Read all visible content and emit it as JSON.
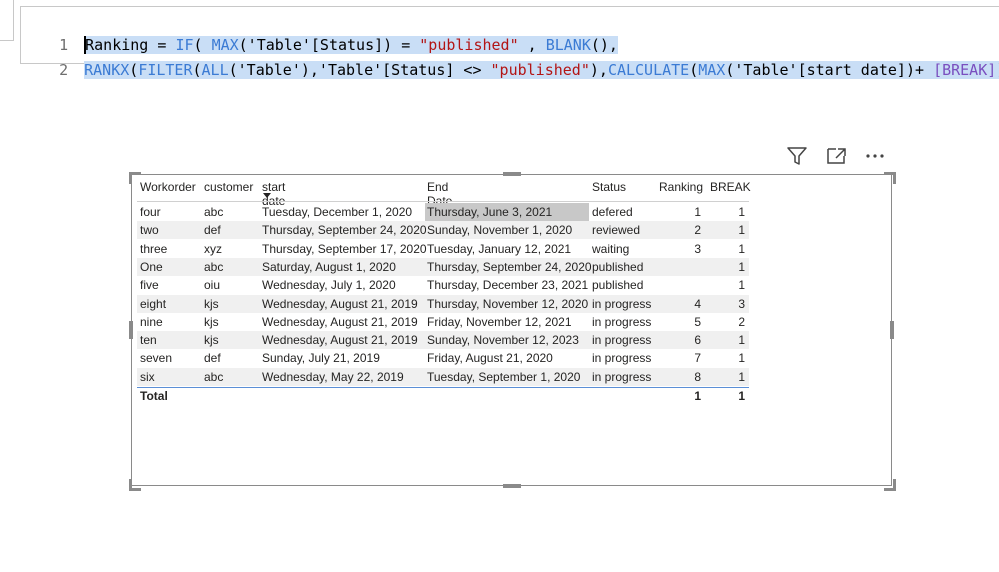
{
  "formula": {
    "line1_number": "1",
    "line2_number": "2",
    "line1": [
      {
        "t": "Ranking = ",
        "c": "tk-default"
      },
      {
        "t": "IF",
        "c": "tk-fn"
      },
      {
        "t": "( ",
        "c": "tk-default"
      },
      {
        "t": "MAX",
        "c": "tk-fn"
      },
      {
        "t": "('Table'[Status]) = ",
        "c": "tk-tbl"
      },
      {
        "t": "\"published\"",
        "c": "tk-str"
      },
      {
        "t": " , ",
        "c": "tk-default"
      },
      {
        "t": "BLANK",
        "c": "tk-fn"
      },
      {
        "t": "(),",
        "c": "tk-default"
      }
    ],
    "line2": [
      {
        "t": "RANKX",
        "c": "tk-fn"
      },
      {
        "t": "(",
        "c": "tk-default"
      },
      {
        "t": "FILTER",
        "c": "tk-fn"
      },
      {
        "t": "(",
        "c": "tk-default"
      },
      {
        "t": "ALL",
        "c": "tk-fn"
      },
      {
        "t": "('Table'),'Table'[Status] <> ",
        "c": "tk-tbl"
      },
      {
        "t": "\"published\"",
        "c": "tk-str"
      },
      {
        "t": "),",
        "c": "tk-default"
      },
      {
        "t": "CALCULATE",
        "c": "tk-fn"
      },
      {
        "t": "(",
        "c": "tk-default"
      },
      {
        "t": "MAX",
        "c": "tk-fn"
      },
      {
        "t": "('Table'[start date])+ ",
        "c": "tk-tbl"
      },
      {
        "t": "[BREAK]",
        "c": "tk-meas"
      },
      {
        "t": ")))",
        "c": "tk-default"
      }
    ]
  },
  "table": {
    "columns": [
      "Workorder",
      "customer",
      "start date",
      "End Date",
      "Status",
      "Ranking",
      "BREAK"
    ],
    "rows": [
      [
        "four",
        "abc",
        "Tuesday, December 1, 2020",
        "Thursday, June 3, 2021",
        "defered",
        "1",
        "1"
      ],
      [
        "two",
        "def",
        "Thursday, September 24, 2020",
        "Sunday, November 1, 2020",
        "reviewed",
        "2",
        "1"
      ],
      [
        "three",
        "xyz",
        "Thursday, September 17, 2020",
        "Tuesday, January 12, 2021",
        "waiting",
        "3",
        "1"
      ],
      [
        "One",
        "abc",
        "Saturday, August 1, 2020",
        "Thursday, September 24, 2020",
        "published",
        "",
        "1"
      ],
      [
        "five",
        "oiu",
        "Wednesday, July 1, 2020",
        "Thursday, December 23, 2021",
        "published",
        "",
        "1"
      ],
      [
        "eight",
        "kjs",
        "Wednesday, August 21, 2019",
        "Thursday, November 12, 2020",
        "in progress",
        "4",
        "3"
      ],
      [
        "nine",
        "kjs",
        "Wednesday, August 21, 2019",
        "Friday, November 12, 2021",
        "in progress",
        "5",
        "2"
      ],
      [
        "ten",
        "kjs",
        "Wednesday, August 21, 2019",
        "Sunday, November 12, 2023",
        "in progress",
        "6",
        "1"
      ],
      [
        "seven",
        "def",
        "Sunday, July 21, 2019",
        "Friday, August 21, 2020",
        "in progress",
        "7",
        "1"
      ],
      [
        "six",
        "abc",
        "Wednesday, May 22, 2019",
        "Tuesday, September 1, 2020",
        "in progress",
        "8",
        "1"
      ]
    ],
    "total": {
      "label": "Total",
      "ranking": "1",
      "break": "1"
    }
  },
  "toolbar": {
    "filter_icon": "filter-icon",
    "focus_icon": "focus-mode-icon",
    "more_icon": "more-options-icon"
  }
}
